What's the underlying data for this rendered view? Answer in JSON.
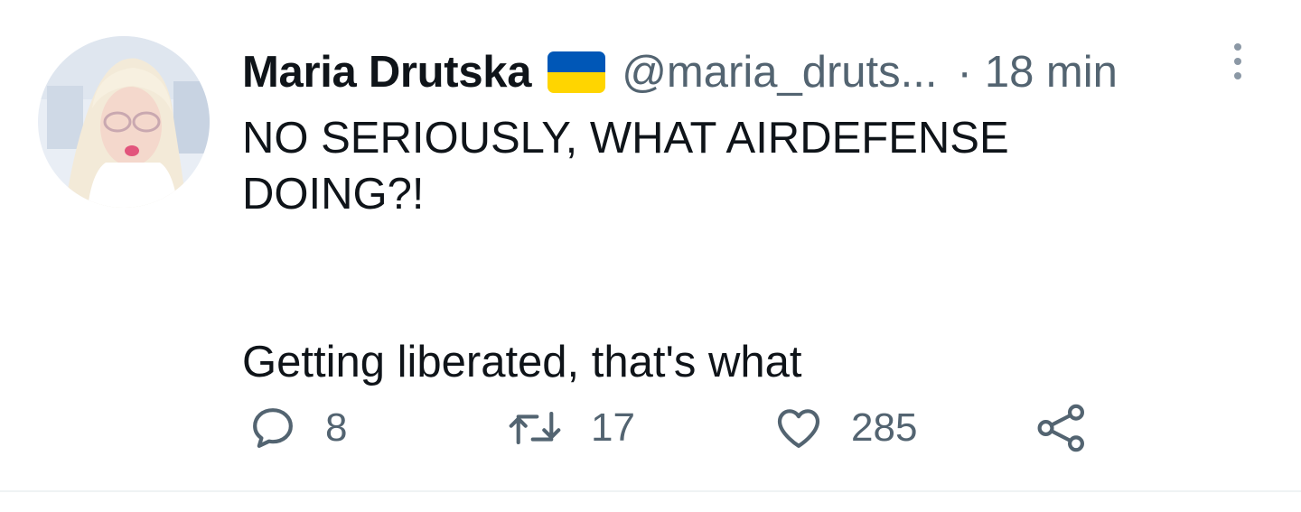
{
  "tweet": {
    "author_name": "Maria Drutska",
    "handle": "@maria_druts...",
    "separator": "·",
    "time": "18 min",
    "flag_colors": [
      "#0057b7",
      "#ffd500"
    ],
    "text_lines": [
      "NO SERIOUSLY, WHAT AIRDEFENSE",
      "DOING?!",
      "Getting liberated, that's what"
    ]
  },
  "actions": {
    "replies": "8",
    "retweets": "17",
    "likes": "285",
    "icons": [
      "reply-icon",
      "retweet-icon",
      "like-icon",
      "share-icon"
    ]
  },
  "colors": {
    "text": "#0f1419",
    "secondary": "#536471",
    "divider": "#eff3f4"
  }
}
